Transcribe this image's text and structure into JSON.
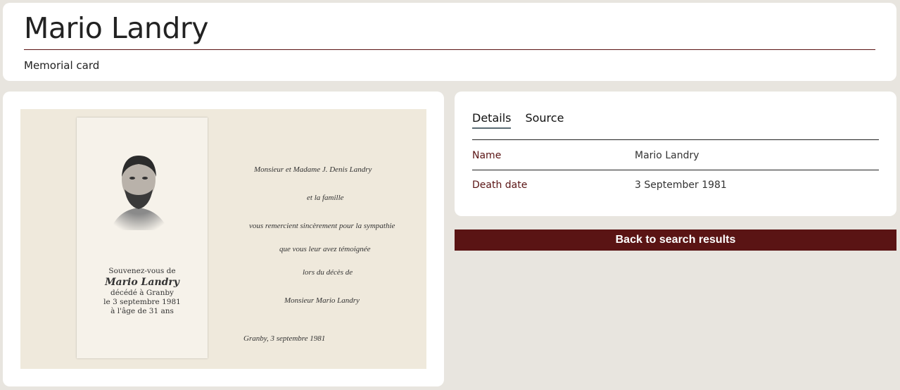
{
  "header": {
    "title": "Mario Landry",
    "subtitle": "Memorial card"
  },
  "memorial_card": {
    "left_text": [
      "Souvenez-vous de",
      "Mario Landry",
      "décédé à Granby",
      "le 3 septembre 1981",
      "à l'âge de 31 ans"
    ],
    "right_text": [
      "Monsieur et Madame J. Denis Landry",
      "et la famille",
      "vous remercient sincèrement pour la sympathie",
      "que vous leur avez témoignée",
      "lors du décès de",
      "Monsieur Mario Landry",
      "Granby, 3 septembre 1981"
    ]
  },
  "tabs": [
    {
      "label": "Details",
      "active": true
    },
    {
      "label": "Source",
      "active": false
    }
  ],
  "details": {
    "name_label": "Name",
    "name_value": "Mario Landry",
    "death_label": "Death date",
    "death_value": "3 September 1981"
  },
  "actions": {
    "back_label": "Back to search results"
  },
  "colors": {
    "accent": "#5a1414",
    "background": "#e8e5df"
  }
}
